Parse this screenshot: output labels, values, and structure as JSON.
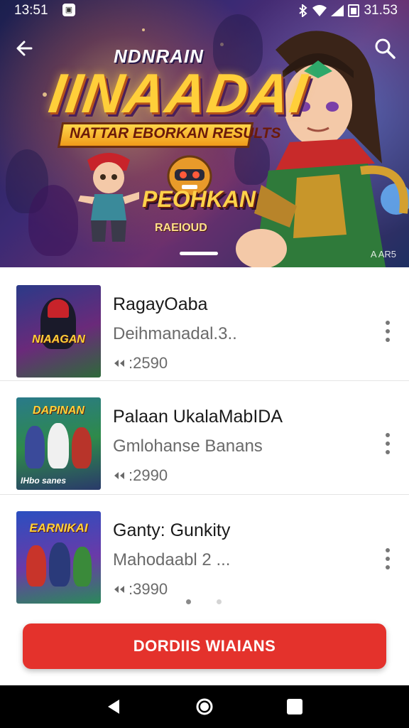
{
  "status_bar": {
    "time": "13:51",
    "right_text": "31.53",
    "app_icon": "notification-app-icon"
  },
  "hero": {
    "title_small": "NDNRAIN",
    "title_big": "IINAADAI",
    "subtitle": "NATTAR EBORKAN RESULTS",
    "tag_big": "PEOHKAN",
    "tag_small": "RAEIOUD",
    "corner_text": "A AR5"
  },
  "items": [
    {
      "title": "RagayOaba",
      "subtitle": "Deihmanadal.3..",
      "count": ":2590",
      "thumb_title": "NIAAGAN",
      "thumb_bottom": "",
      "thumb_bg": "#2f3d8a"
    },
    {
      "title": "Palaan UkalaMabIDA",
      "subtitle": "Gmlohanse Banans",
      "count": ":2990",
      "thumb_title": "DAPINAN",
      "thumb_bottom": "IHbo sanes",
      "thumb_bg": "#2e8a4a"
    },
    {
      "title": "Ganty: Gunkity",
      "subtitle": "Mahodaabl 2 ...",
      "count": ":3990",
      "thumb_title": "EARNIKAI",
      "thumb_bottom": "",
      "thumb_bg": "#3a4fb0"
    }
  ],
  "cta": {
    "label": "DORDIIS WIAIANS"
  },
  "colors": {
    "accent": "#e4322c",
    "hero_title": "#ffcf3a",
    "text_primary": "#1a1a1a",
    "text_secondary": "#6a6a6a"
  }
}
